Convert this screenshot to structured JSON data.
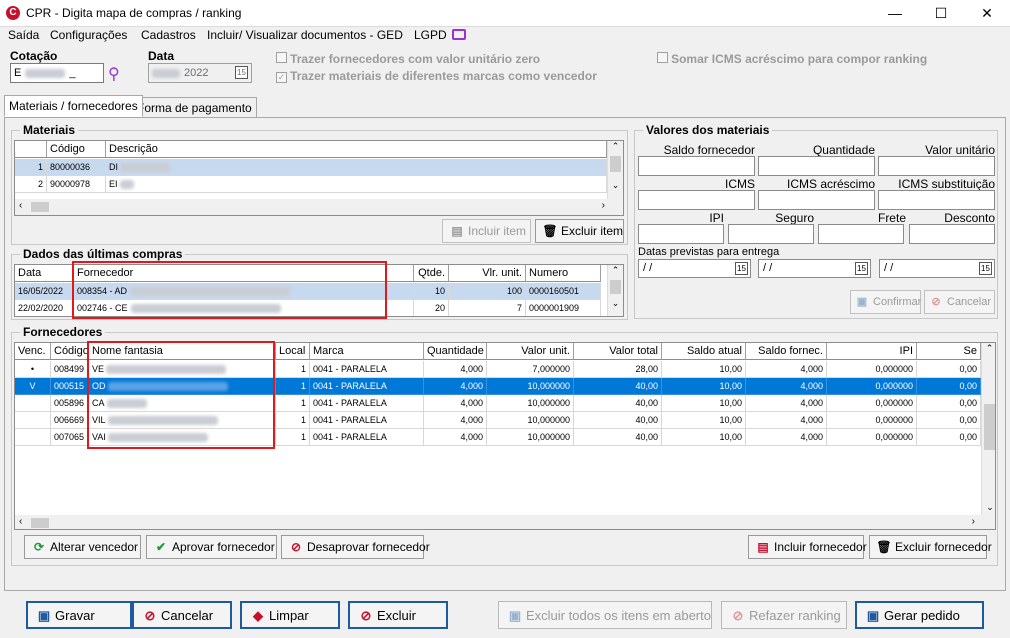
{
  "window": {
    "title": "CPR - Digita mapa de compras / ranking",
    "minimize": "—",
    "maximize": "☐",
    "close": "✕"
  },
  "menu": [
    "Saída",
    "Configurações",
    "Cadastros",
    "Incluir/ Visualizar documentos - GED",
    "LGPD"
  ],
  "header": {
    "cotacao_label": "Cotação",
    "cotacao_value": "E",
    "cotacao_suffix": "_",
    "data_label": "Data",
    "data_value": "2022",
    "cal": "15",
    "chk1": "Trazer fornecedores com valor unitário zero",
    "chk2": "Trazer materiais de diferentes marcas como vencedor",
    "chk3": "Somar ICMS acréscimo para compor ranking"
  },
  "tabs": [
    "Materiais / fornecedores",
    "Forma de pagamento"
  ],
  "materiais": {
    "title": "Materiais",
    "columns": [
      "Código",
      "Descrição"
    ],
    "rows": [
      {
        "n": "1",
        "codigo": "80000036",
        "desc": "DI"
      },
      {
        "n": "2",
        "codigo": "90000978",
        "desc": "EI"
      }
    ],
    "incluir": "Incluir item",
    "excluir": "Excluir item"
  },
  "ultimas": {
    "title": "Dados das últimas compras",
    "columns": [
      "Data",
      "Fornecedor",
      "Qtde.",
      "Vlr. unit.",
      "Numero"
    ],
    "rows": [
      {
        "data": "16/05/2022",
        "forn": "008354 - AD",
        "qtde": "10",
        "vlr": "100",
        "num": "0000160501"
      },
      {
        "data": "22/02/2020",
        "forn": "002746 - CE",
        "qtde": "20",
        "vlr": "7",
        "num": "0000001909"
      }
    ]
  },
  "valores": {
    "title": "Valores dos materiais",
    "labels": {
      "saldo": "Saldo fornecedor",
      "quantidade": "Quantidade",
      "valor_unit": "Valor unitário",
      "icms": "ICMS",
      "icms_acr": "ICMS acréscimo",
      "icms_sub": "ICMS substituição",
      "ipi": "IPI",
      "seguro": "Seguro",
      "frete": "Frete",
      "desconto": "Desconto",
      "datas": "Datas previstas para entrega"
    },
    "date_placeholder": "/ /",
    "confirmar": "Confirmar",
    "cancelar": "Cancelar"
  },
  "fornecedores": {
    "title": "Fornecedores",
    "columns": [
      "Venc.",
      "Código",
      "Nome fantasia",
      "Local",
      "Marca",
      "Quantidade",
      "Valor unit.",
      "Valor total",
      "Saldo atual",
      "Saldo fornec.",
      "IPI",
      "Se"
    ],
    "rows": [
      {
        "venc": "•",
        "codigo": "008499",
        "nome": "VE",
        "local": "1",
        "marca": "0041 - PARALELA",
        "qtd": "4,000",
        "vu": "7,000000",
        "vt": "28,00",
        "sa": "10,00",
        "sf": "4,000",
        "ipi": "0,000000",
        "se": "0,00"
      },
      {
        "venc": "V",
        "codigo": "000515",
        "nome": "OD",
        "local": "1",
        "marca": "0041 - PARALELA",
        "qtd": "4,000",
        "vu": "10,000000",
        "vt": "40,00",
        "sa": "10,00",
        "sf": "4,000",
        "ipi": "0,000000",
        "se": "0,00"
      },
      {
        "venc": "",
        "codigo": "005896",
        "nome": "CA",
        "local": "1",
        "marca": "0041 - PARALELA",
        "qtd": "4,000",
        "vu": "10,000000",
        "vt": "40,00",
        "sa": "10,00",
        "sf": "4,000",
        "ipi": "0,000000",
        "se": "0,00"
      },
      {
        "venc": "",
        "codigo": "006669",
        "nome": "VIL",
        "local": "1",
        "marca": "0041 - PARALELA",
        "qtd": "4,000",
        "vu": "10,000000",
        "vt": "40,00",
        "sa": "10,00",
        "sf": "4,000",
        "ipi": "0,000000",
        "se": "0,00"
      },
      {
        "venc": "",
        "codigo": "007065",
        "nome": "VAI",
        "local": "1",
        "marca": "0041 - PARALELA",
        "qtd": "4,000",
        "vu": "10,000000",
        "vt": "40,00",
        "sa": "10,00",
        "sf": "4,000",
        "ipi": "0,000000",
        "se": "0,00"
      }
    ],
    "alterar": "Alterar vencedor",
    "aprovar": "Aprovar fornecedor",
    "desaprovar": "Desaprovar fornecedor",
    "incluir": "Incluir fornecedor",
    "excluir": "Excluir fornecedor"
  },
  "footer": {
    "gravar": "Gravar",
    "cancelar": "Cancelar",
    "limpar": "Limpar",
    "excluir": "Excluir",
    "excluir_todos": "Excluir todos os itens em aberto",
    "refazer": "Refazer ranking",
    "gerar": "Gerar pedido"
  }
}
